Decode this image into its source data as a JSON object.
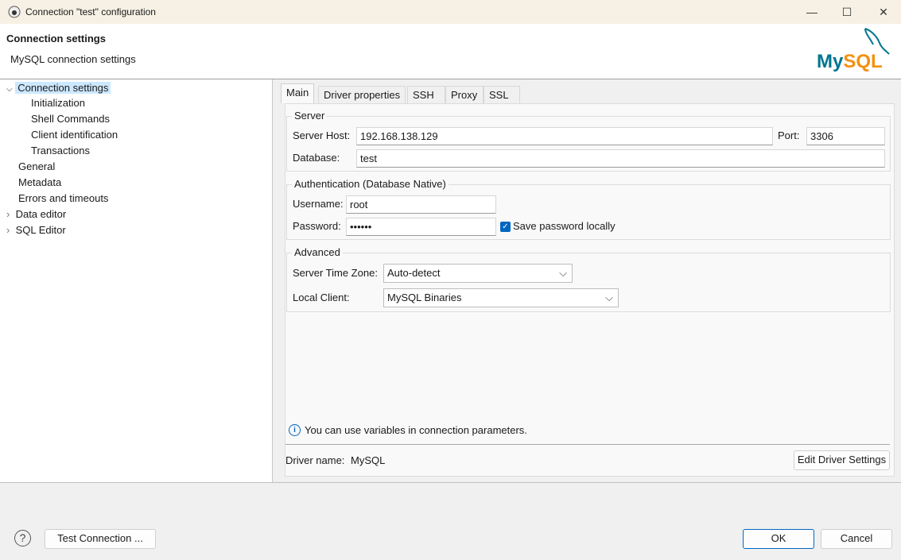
{
  "window": {
    "title": "Connection \"test\" configuration",
    "minimize": "—",
    "maximize": "☐",
    "close": "✕"
  },
  "header": {
    "title": "Connection settings",
    "subtitle": "MySQL connection settings",
    "logo_text": "MySQL"
  },
  "tree": {
    "items": [
      {
        "label": "Connection settings",
        "expanded": true,
        "selected": true
      },
      {
        "label": "Initialization"
      },
      {
        "label": "Shell Commands"
      },
      {
        "label": "Client identification"
      },
      {
        "label": "Transactions"
      },
      {
        "label": "General"
      },
      {
        "label": "Metadata"
      },
      {
        "label": "Errors and timeouts"
      },
      {
        "label": "Data editor",
        "expandable": true
      },
      {
        "label": "SQL Editor",
        "expandable": true
      }
    ]
  },
  "tabs": [
    {
      "label": "Main",
      "active": true
    },
    {
      "label": "Driver properties"
    },
    {
      "label": "SSH"
    },
    {
      "label": "Proxy"
    },
    {
      "label": "SSL"
    }
  ],
  "server": {
    "legend": "Server",
    "host_label": "Server Host:",
    "host": "192.168.138.129",
    "port_label": "Port:",
    "port": "3306",
    "database_label": "Database:",
    "database": "test"
  },
  "auth": {
    "legend": "Authentication (Database Native)",
    "username_label": "Username:",
    "username": "root",
    "password_label": "Password:",
    "password": "••••••",
    "save_password_label": "Save password locally",
    "save_password": true
  },
  "advanced": {
    "legend": "Advanced",
    "timezone_label": "Server Time Zone:",
    "timezone": "Auto-detect",
    "client_label": "Local Client:",
    "client": "MySQL Binaries"
  },
  "info": {
    "text": "You can use variables in connection parameters."
  },
  "driver": {
    "label": "Driver name:",
    "value": "MySQL",
    "edit_button": "Edit Driver Settings"
  },
  "footer": {
    "help": "?",
    "test_button": "Test Connection ...",
    "ok": "OK",
    "cancel": "Cancel"
  },
  "colors": {
    "accent": "#0067c0",
    "selection": "#cce8ff",
    "mysql_blue": "#00758f",
    "mysql_orange": "#f29111"
  }
}
